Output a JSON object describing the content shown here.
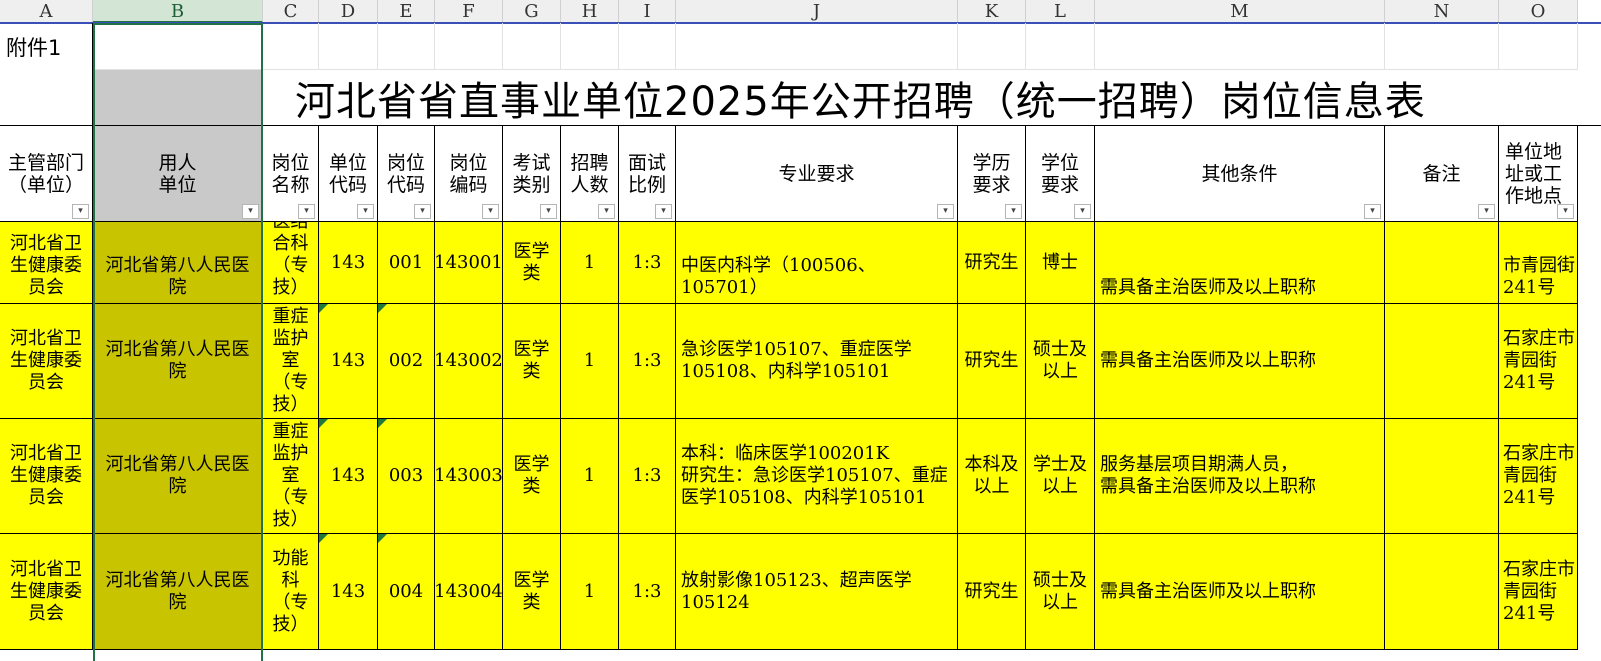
{
  "columns": [
    "A",
    "B",
    "C",
    "D",
    "E",
    "F",
    "G",
    "H",
    "I",
    "J",
    "K",
    "L",
    "M",
    "N",
    "O"
  ],
  "attachment_label": "附件1",
  "title": "河北省省直事业单位2025年公开招聘（统一招聘）岗位信息表",
  "headers": {
    "A": "主管部门（单位）",
    "B": "用人\n单位",
    "C": "岗位\n名称",
    "D": "单位\n代码",
    "E": "岗位\n代码",
    "F": "岗位\n编码",
    "G": "考试\n类别",
    "H": "招聘\n人数",
    "I": "面试\n比例",
    "J": "专业要求",
    "K": "学历\n要求",
    "L": "学位\n要求",
    "M": "其他条件",
    "N": "备注",
    "O": "单位地址或工作地点"
  },
  "filter_glyph": "▾",
  "rows": [
    {
      "dept": "河北省卫生健康委员会",
      "unit": "河北省第八人民医院",
      "post": "医结合科（专技）",
      "unit_code": "143",
      "post_code": "001",
      "post_id": "143001",
      "exam": "医学类",
      "count": "1",
      "ratio": "1:3",
      "major": "中医内科学（100506、105701）",
      "edu": "研究生",
      "degree": "博士",
      "other": "需具备主治医师及以上职称",
      "note": "",
      "addr": "市青园街 241号"
    },
    {
      "dept": "河北省卫生健康委员会",
      "unit": "河北省第八人民医院",
      "post": "重症监护室（专技）",
      "unit_code": "143",
      "post_code": "002",
      "post_id": "143002",
      "exam": "医学类",
      "count": "1",
      "ratio": "1:3",
      "major": "急诊医学105107、重症医学105108、内科学105101",
      "edu": "研究生",
      "degree": "硕士及以上",
      "other": "需具备主治医师及以上职称",
      "note": "",
      "addr": "石家庄市青园街 241号"
    },
    {
      "dept": "河北省卫生健康委员会",
      "unit": "河北省第八人民医院",
      "post": "重症监护室（专技）",
      "unit_code": "143",
      "post_code": "003",
      "post_id": "143003",
      "exam": "医学类",
      "count": "1",
      "ratio": "1:3",
      "major": "本科：临床医学100201K\n研究生：急诊医学105107、重症医学105108、内科学105101",
      "edu": "本科及以上",
      "degree": "学士及以上",
      "other": "服务基层项目期满人员，\n需具备主治医师及以上职称",
      "note": "",
      "addr": "石家庄市青园街 241号"
    },
    {
      "dept": "河北省卫生健康委员会",
      "unit": "河北省第八人民医院",
      "post": "功能科（专技）",
      "unit_code": "143",
      "post_code": "004",
      "post_id": "143004",
      "exam": "医学类",
      "count": "1",
      "ratio": "1:3",
      "major": "放射影像105123、超声医学105124",
      "edu": "研究生",
      "degree": "硕士及以上",
      "other": "需具备主治医师及以上职称",
      "note": "",
      "addr": "石家庄市青园街 241号"
    }
  ],
  "colors": {
    "highlight": "#ffff00",
    "unit_fill": "#c8c400",
    "header_grey": "#c9c9c9",
    "selection": "#217346"
  }
}
